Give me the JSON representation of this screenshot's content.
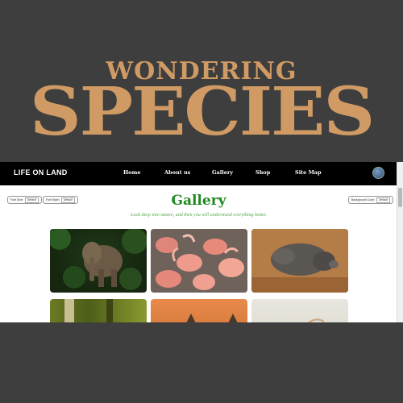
{
  "brand": {
    "line1": "WONDERING",
    "line2": "SPECIES"
  },
  "navbar": {
    "title": "LIFE ON LAND",
    "links": [
      "Home",
      "About us",
      "Gallery",
      "Shop",
      "Site Map"
    ]
  },
  "controls": {
    "font_size": {
      "label": "Font Size:",
      "value": "Default"
    },
    "font_style": {
      "label": "Font Style:",
      "value": "Default"
    },
    "background_color": {
      "label": "Background Color:",
      "value": "Default"
    }
  },
  "main": {
    "title": "Gallery",
    "tagline": "Look deep into nature, and then you will understand everything better."
  },
  "gallery": {
    "images": [
      {
        "subject": "elephant"
      },
      {
        "subject": "flamingos"
      },
      {
        "subject": "pig"
      },
      {
        "subject": "forest"
      },
      {
        "subject": "fox"
      },
      {
        "subject": "bird"
      }
    ]
  },
  "colors": {
    "brand": "#cf9a63",
    "title_green": "#1e8a1e",
    "tagline_green": "#55a84a",
    "navbar": "#000000",
    "background": "#3e3e3e"
  }
}
